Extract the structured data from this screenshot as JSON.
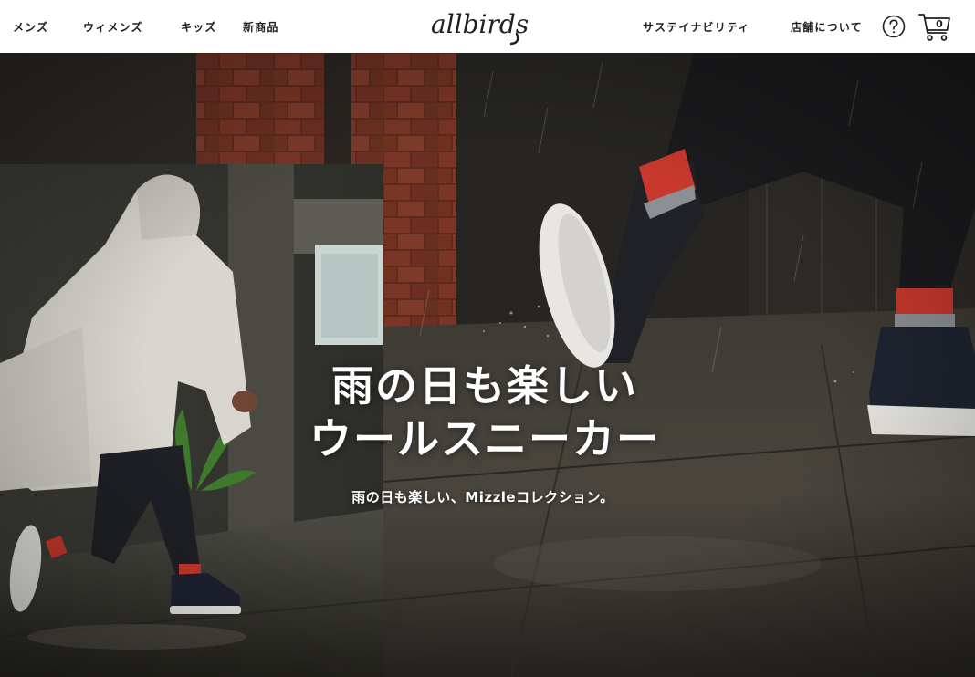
{
  "header": {
    "nav_left": [
      {
        "label": "メンズ"
      },
      {
        "label": "ウィメンズ"
      },
      {
        "label": "キッズ"
      },
      {
        "label": "新商品"
      }
    ],
    "logo_text": "allbirds",
    "nav_right": [
      {
        "label": "サステイナビリティ"
      },
      {
        "label": "店舗について"
      }
    ],
    "help_icon": "question-circle-icon",
    "cart_icon": "shopping-cart-icon",
    "cart_count": "0"
  },
  "hero": {
    "title_line1": "雨の日も楽しい",
    "title_line2": "ウールスニーカー",
    "subtitle": "雨の日も楽しい、Mizzleコレクション。"
  },
  "colors": {
    "header_bg": "#ffffff",
    "text": "#212121",
    "hero_text": "#ffffff",
    "sock_red": "#c8382c",
    "brick": "#6e2f22"
  }
}
